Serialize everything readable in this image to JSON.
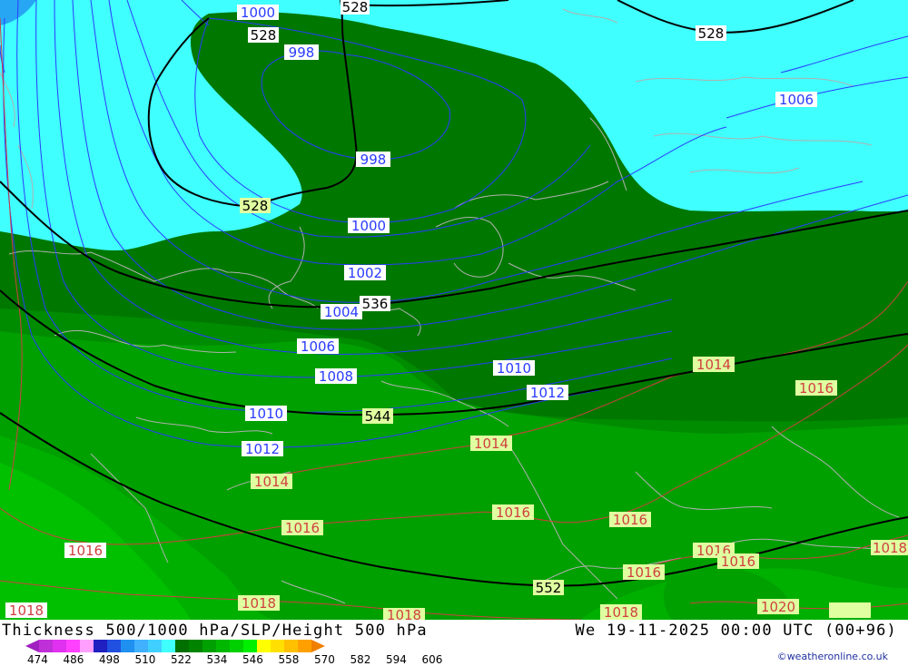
{
  "header": {
    "title": "Thickness 500/1000 hPa/SLP/Height 500 hPa",
    "datetime": "We 19-11-2025 00:00 UTC (00+96)",
    "credit": "©weatheronline.co.uk"
  },
  "legend": {
    "ticks": [
      "474",
      "486",
      "498",
      "510",
      "522",
      "534",
      "546",
      "558",
      "570",
      "582",
      "594",
      "606"
    ],
    "colors": [
      "#a020c0",
      "#c030d8",
      "#e030f0",
      "#ff40ff",
      "#ffa0ff",
      "#2020c0",
      "#2050e0",
      "#2090f0",
      "#40b0ff",
      "#40d0ff",
      "#40ffff",
      "#007000",
      "#008400",
      "#00a000",
      "#00b800",
      "#00d000",
      "#00f000",
      "#ffff00",
      "#ffe000",
      "#ffc000",
      "#ffa000",
      "#f08000"
    ]
  },
  "map": {
    "colors": {
      "band_522": "#40ffff",
      "band_528": "#007800",
      "band_540": "#008c00",
      "band_546": "#00a000",
      "band_552": "#00b000",
      "band_558": "#00c000",
      "height_line": "#000000",
      "isobar_low": "#2a3cff",
      "isobar_high": "#d04040",
      "coastline": "#b0b0b0"
    },
    "height_labels": [
      "528",
      "528",
      "528",
      "528",
      "536",
      "544",
      "552"
    ],
    "low_isobar_labels": [
      "1000",
      "998",
      "998",
      "1000",
      "1002",
      "1004",
      "1006",
      "1006",
      "1008",
      "1010",
      "1010",
      "1012",
      "1012"
    ],
    "high_isobar_labels": [
      "1014",
      "1014",
      "1014",
      "1016",
      "1016",
      "1016",
      "1016",
      "1016",
      "1016",
      "1016",
      "1016",
      "1018",
      "1018",
      "1018",
      "1018",
      "1018",
      "1020"
    ]
  }
}
